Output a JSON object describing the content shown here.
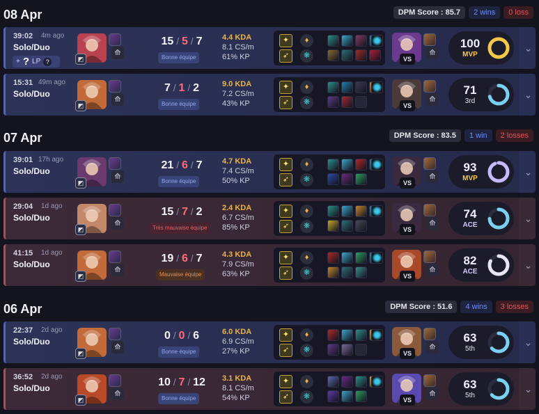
{
  "days": [
    {
      "title": "08 Apr",
      "dpm": "DPM Score : 85.7",
      "wins": "2 wins",
      "losses": "0 loss"
    },
    {
      "title": "07 Apr",
      "dpm": "DPM Score : 83.5",
      "wins": "1 win",
      "losses": "2 losses"
    },
    {
      "title": "06 Apr",
      "dpm": "DPM Score : 51.6",
      "wins": "4 wins",
      "losses": "3 losses"
    }
  ],
  "lp_badge": {
    "mark": "+",
    "q": "?",
    "label": "LP",
    "help": "?"
  },
  "vs_label": "VS",
  "expand_icon": "⌄",
  "matches": [
    {
      "result": "victory",
      "duration": "39:02",
      "ago": "4m ago",
      "queue": "Solo/Duo",
      "kills": "15",
      "deaths": "5",
      "assists": "7",
      "team_tag": "Bonne équipe",
      "team_tag_type": "good",
      "kda": "4.4 KDA",
      "cs": "8.1 CS/m",
      "kp": "61% KP",
      "score": "100",
      "score_sub": "MVP",
      "score_sub_type": "mvp",
      "score_fill": 1.0,
      "ring_color": "#f5c84a",
      "champ_color": "#b8424f",
      "opp_color": "#6b3a8e",
      "items": [
        "#2c8f8a",
        "#3aa7c8",
        "#7f3a5e",
        "#1c8ab0",
        "#8a6a30",
        "#2d6f77",
        "#a02a2a",
        "#b01c3a"
      ]
    },
    {
      "result": "victory",
      "duration": "15:31",
      "ago": "49m ago",
      "queue": "Solo/Duo",
      "kills": "7",
      "deaths": "1",
      "assists": "2",
      "team_tag": "Bonne équipe",
      "team_tag_type": "good",
      "kda": "9.0 KDA",
      "cs": "7.2 CS/m",
      "kp": "43% KP",
      "score": "71",
      "score_sub": "3rd",
      "score_sub_type": "rank",
      "score_fill": 0.71,
      "ring_color": "#7ad0f0",
      "champ_color": "#c26a3a",
      "opp_color": "#4a3a3a",
      "items": [
        "#2c8f8a",
        "#1e7fa8",
        "#3a3a50",
        "#c4862a",
        "#5e3a86",
        "#a32a3a",
        "empty"
      ]
    },
    {
      "result": "victory",
      "duration": "39:01",
      "ago": "17h ago",
      "queue": "Solo/Duo",
      "kills": "21",
      "deaths": "6",
      "assists": "7",
      "team_tag": "Bonne équipe",
      "team_tag_type": "good",
      "kda": "4.7 KDA",
      "cs": "7.4 CS/m",
      "kp": "50% KP",
      "score": "93",
      "score_sub": "MVP",
      "score_sub_type": "mvp",
      "score_fill": 0.93,
      "ring_color": "#c7b9ff",
      "champ_color": "#6a3a6e",
      "opp_color": "#3a2a40",
      "items": [
        "#2c8f8a",
        "#3aa7c8",
        "#b0282a",
        "#1c8ab0",
        "#2a4aa8",
        "#6a2a7a",
        "#2d9e62"
      ]
    },
    {
      "result": "defeat",
      "duration": "29:04",
      "ago": "1d ago",
      "queue": "Solo/Duo",
      "kills": "15",
      "deaths": "7",
      "assists": "2",
      "team_tag": "Très mauvaise équipe",
      "team_tag_type": "verybad",
      "kda": "2.4 KDA",
      "cs": "6.7 CS/m",
      "kp": "85% KP",
      "score": "74",
      "score_sub": "ACE",
      "score_sub_type": "ace",
      "score_fill": 0.74,
      "ring_color": "#7ad0f0",
      "champ_color": "#c2886a",
      "opp_color": "#3a2a40",
      "items": [
        "#2c8f8a",
        "#3aa7c8",
        "#c4862a",
        "#1c8ab0",
        "#c4a62a",
        "#2d6f77",
        "#4a4a5a"
      ]
    },
    {
      "result": "defeat",
      "duration": "41:15",
      "ago": "1d ago",
      "queue": "Solo/Duo",
      "kills": "19",
      "deaths": "6",
      "assists": "7",
      "team_tag": "Mauvaise équipe",
      "team_tag_type": "bad",
      "kda": "4.3 KDA",
      "cs": "7.9 CS/m",
      "kp": "63% KP",
      "score": "82",
      "score_sub": "ACE",
      "score_sub_type": "ace",
      "score_fill": 0.82,
      "ring_color": "#e6e6f5",
      "champ_color": "#c26a3a",
      "opp_color": "#a84a2a",
      "items": [
        "#b0282a",
        "#3aa7c8",
        "#2d9e62",
        "#1c8ab0",
        "#c4862a",
        "#2d6f77",
        "#3a8a8a"
      ]
    },
    {
      "result": "victory",
      "duration": "22:37",
      "ago": "2d ago",
      "queue": "Solo/Duo",
      "kills": "0",
      "deaths": "0",
      "assists": "6",
      "team_tag": "Bonne équipe",
      "team_tag_type": "good",
      "kda": "6.0 KDA",
      "cs": "6.9 CS/m",
      "kp": "27% KP",
      "score": "63",
      "score_sub": "5th",
      "score_sub_type": "rank",
      "score_fill": 0.63,
      "ring_color": "#7ad0f0",
      "champ_color": "#c26a3a",
      "opp_color": "#8a5a3a",
      "items": [
        "#b0282a",
        "#3aa7c8",
        "#2c8f8a",
        "#c4a62a",
        "#5e3a86",
        "#7a6a9a",
        "empty"
      ]
    },
    {
      "result": "defeat",
      "duration": "36:52",
      "ago": "2d ago",
      "queue": "Solo/Duo",
      "kills": "10",
      "deaths": "7",
      "assists": "12",
      "team_tag": "Bonne équipe",
      "team_tag_type": "good",
      "kda": "3.1 KDA",
      "cs": "8.1 CS/m",
      "kp": "54% KP",
      "score": "63",
      "score_sub": "5th",
      "score_sub_type": "rank",
      "score_fill": 0.63,
      "ring_color": "#7ad0f0",
      "champ_color": "#b84a2a",
      "opp_color": "#5a4ab0",
      "items": [
        "#5a6ab0",
        "#6a2a8a",
        "#2c8f8a",
        "#c4a62a",
        "#5e3aa6",
        "#3aa7c8",
        "#2d9e62"
      ]
    }
  ]
}
